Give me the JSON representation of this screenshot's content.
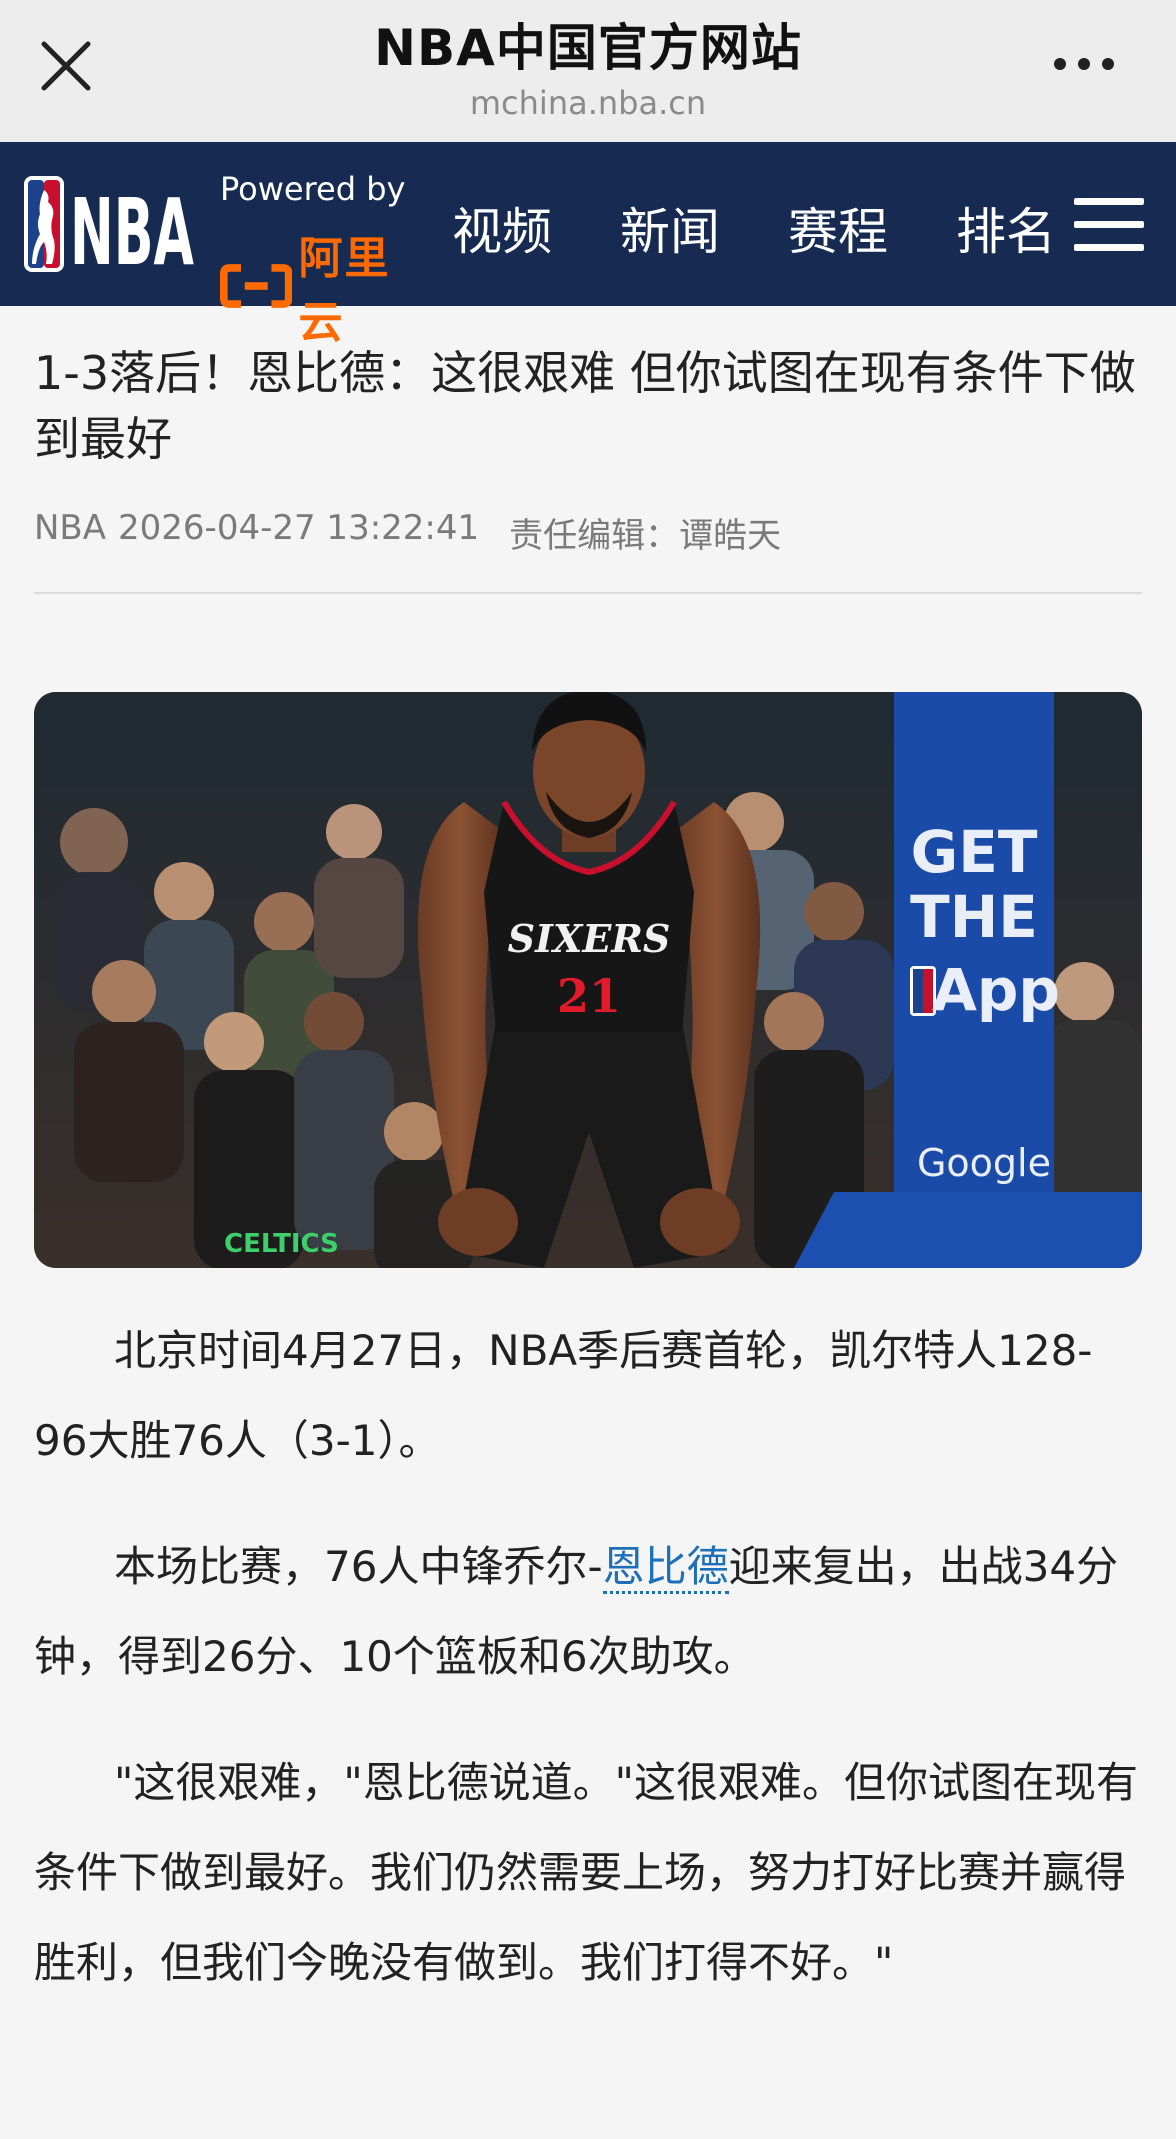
{
  "browser": {
    "title": "NBA中国官方网站",
    "url": "mchina.nba.cn"
  },
  "nav": {
    "logo_text": "NBA",
    "powered_by": "Powered by",
    "partner": "阿里云",
    "items": [
      "视频",
      "新闻",
      "赛程",
      "排名"
    ]
  },
  "article": {
    "headline": "1-3落后！恩比德：这很艰难 但你试图在现有条件下做到最好",
    "source": "NBA",
    "datetime": "2026-04-27 13:22:41",
    "editor_label": "责任编辑：",
    "editor": "谭皓天",
    "photo": {
      "jersey_team": "SIXERS",
      "jersey_number": "21",
      "ad_text": [
        "GET",
        "THE",
        "App"
      ],
      "sponsor": "Google",
      "fan_shirt": "CELTICS"
    },
    "paragraph1": "北京时间4月27日，NBA季后赛首轮，凯尔特人128-96大胜76人（3-1）。",
    "paragraph2_before": "本场比赛，76人中锋乔尔-",
    "paragraph2_link": "恩比德",
    "paragraph2_after": "迎来复出，出战34分钟，得到26分、10个篮板和6次助攻。",
    "paragraph3": "\"这很艰难，\"恩比德说道。\"这很艰难。但你试图在现有条件下做到最好。我们仍然需要上场，努力打好比赛并赢得胜利，但我们今晚没有做到。我们打得不好。\""
  }
}
